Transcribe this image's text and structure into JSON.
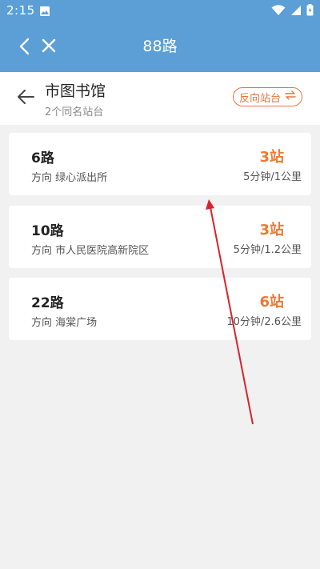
{
  "status_bar": {
    "time": "2:15",
    "icons": [
      "image-icon",
      "wifi-icon",
      "signal-icon",
      "battery-charging-icon"
    ]
  },
  "nav": {
    "title": "88路",
    "icons": [
      "back-chevron-icon",
      "close-icon"
    ]
  },
  "station": {
    "name": "市图书馆",
    "subtitle": "2个同名站台",
    "reverse_label": "反向站台",
    "reverse_icon": "swap-arrows-icon"
  },
  "routes": [
    {
      "name": "6路",
      "direction": "方向 绿心派出所",
      "stops": "3站",
      "time_distance": "5分钟/1公里"
    },
    {
      "name": "10路",
      "direction": "方向 市人民医院高新院区",
      "stops": "3站",
      "time_distance": "5分钟/1.2公里"
    },
    {
      "name": "22路",
      "direction": "方向 海棠广场",
      "stops": "6站",
      "time_distance": "10分钟/2.6公里"
    }
  ],
  "colors": {
    "header_blue": "#5b9fd6",
    "accent_orange": "#ef7a30",
    "annotation_red": "#d9232a"
  }
}
